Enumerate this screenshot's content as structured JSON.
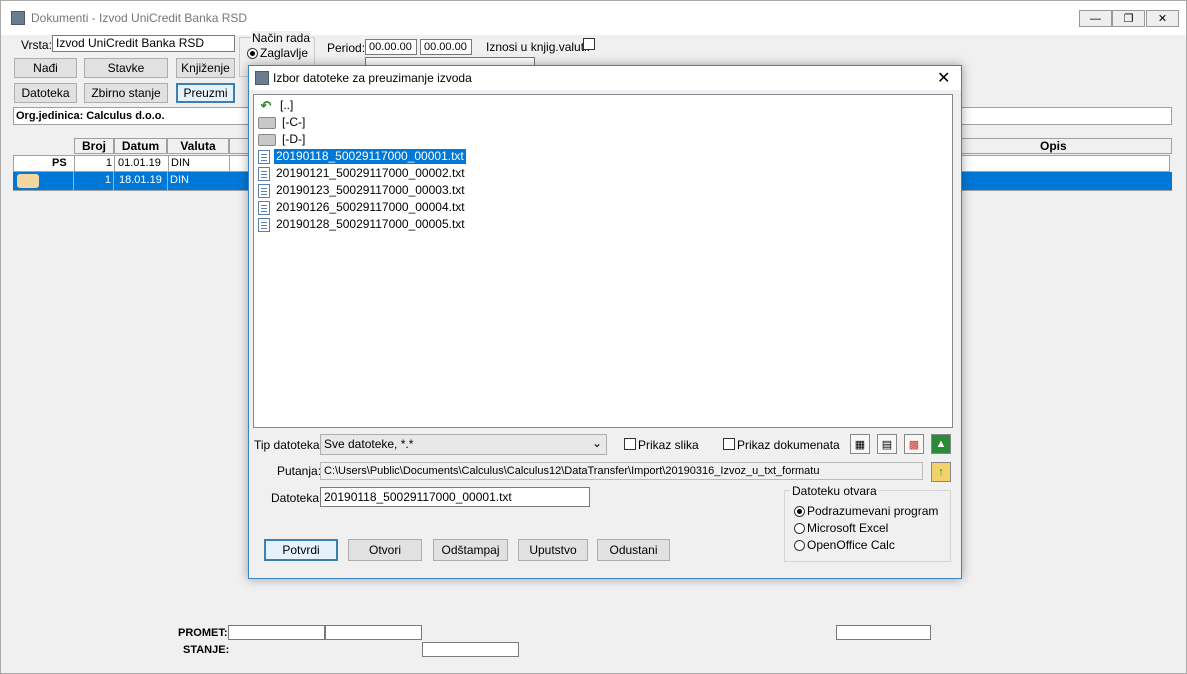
{
  "window": {
    "title": "Dokumenti - Izvod UniCredit Banka RSD"
  },
  "toolbar": {
    "vrsta_label": "Vrsta:",
    "vrsta_value": "Izvod UniCredit Banka RSD",
    "nacin_rada_label": "Način rada",
    "zaglavlje_label": "Zaglavlje",
    "period_label": "Period:",
    "period_from": "00.00.00",
    "period_to": "00.00.00",
    "iznosi_label": "Iznosi u knjig.valuti:",
    "buttons": {
      "nadji": "Nađi",
      "stavke": "Stavke",
      "knjizenje": "Knjiženje",
      "datoteka": "Datoteka",
      "zbirno": "Zbirno stanje",
      "preuzmi": "Preuzmi"
    },
    "org_jedinica": "Org.jedinica: Calculus d.o.o."
  },
  "grid": {
    "headers": {
      "broj": "Broj",
      "datum": "Datum",
      "valuta": "Valuta",
      "opis": "Opis"
    },
    "rows": [
      {
        "marker": "PS",
        "broj": "1",
        "datum": "01.01.19",
        "valuta": "DIN"
      },
      {
        "marker": "",
        "broj": "1",
        "datum": "18.01.19",
        "valuta": "DIN"
      }
    ]
  },
  "footer": {
    "promet": "PROMET:",
    "stanje": "STANJE:"
  },
  "dialog": {
    "title": "Izbor datoteke za preuzimanje izvoda",
    "files": [
      {
        "name": "[..]",
        "kind": "up"
      },
      {
        "name": "[-C-]",
        "kind": "drive"
      },
      {
        "name": "[-D-]",
        "kind": "drive"
      },
      {
        "name": "20190118_50029117000_00001.txt",
        "kind": "txt",
        "selected": true
      },
      {
        "name": "20190121_50029117000_00002.txt",
        "kind": "txt"
      },
      {
        "name": "20190123_50029117000_00003.txt",
        "kind": "txt"
      },
      {
        "name": "20190126_50029117000_00004.txt",
        "kind": "txt"
      },
      {
        "name": "20190128_50029117000_00005.txt",
        "kind": "txt"
      }
    ],
    "tip_label": "Tip datoteka:",
    "tip_value": "Sve datoteke, *.*",
    "prikaz_slika": "Prikaz slika",
    "prikaz_dokumenata": "Prikaz dokumenata",
    "putanja_label": "Putanja:",
    "putanja_value": "C:\\Users\\Public\\Documents\\Calculus\\Calculus12\\DataTransfer\\Import\\20190316_Izvoz_u_txt_formatu",
    "datoteka_label": "Datoteka:",
    "datoteka_value": "20190118_50029117000_00001.txt",
    "otvara_title": "Datoteku otvara",
    "otvara_options": [
      "Podrazumevani program",
      "Microsoft Excel",
      "OpenOffice Calc"
    ],
    "buttons": {
      "potvrdi": "Potvrdi",
      "otvori": "Otvori",
      "odstampaj": "Odštampaj",
      "uputstvo": "Uputstvo",
      "odustani": "Odustani"
    }
  },
  "colors": {
    "selection": "#0078d7",
    "accent": "#3c7fb1"
  }
}
